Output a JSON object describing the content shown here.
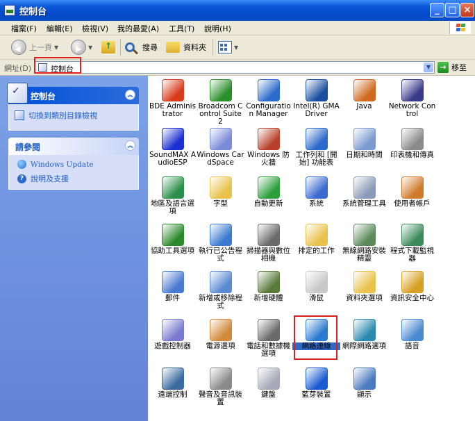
{
  "window": {
    "title": "控制台"
  },
  "menu": [
    "檔案(F)",
    "編輯(E)",
    "檢視(V)",
    "我的最愛(A)",
    "工具(T)",
    "說明(H)"
  ],
  "toolbar": {
    "back_label": "上一頁",
    "search_label": "搜尋",
    "folders_label": "資料夾"
  },
  "address": {
    "label": "網址(D)",
    "value": "控制台",
    "go_label": "移至"
  },
  "left_pane": {
    "panel1_title": "控制台",
    "switch_link": "切換到類別目錄檢視",
    "panel2_title": "請參閱",
    "see_also": [
      "Windows Update",
      "說明及支援"
    ]
  },
  "icons": [
    {
      "label": "BDE Administrator",
      "icon": "bde-icon",
      "color": "#d83a1a"
    },
    {
      "label": "Broadcom Control Suite 2",
      "icon": "broadcom-icon",
      "color": "#2a8f2a"
    },
    {
      "label": "Configuration Manager",
      "icon": "config-manager-icon",
      "color": "#2b6acb"
    },
    {
      "label": "Intel(R) GMA Driver",
      "icon": "intel-gma-icon",
      "color": "#1a4fa0"
    },
    {
      "label": "Java",
      "icon": "java-icon",
      "color": "#d06a1e"
    },
    {
      "label": "Network Control",
      "icon": "network-control-icon",
      "color": "#3a3a8a"
    },
    {
      "label": "SoundMAX AudioESP",
      "icon": "soundmax-icon",
      "color": "#1a2fd0"
    },
    {
      "label": "Windows CardSpace",
      "icon": "cardspace-icon",
      "color": "#7a8bd8"
    },
    {
      "label": "Windows 防火牆",
      "icon": "firewall-icon",
      "color": "#b8402a"
    },
    {
      "label": "工作列和 [開始] 功能表",
      "icon": "taskbar-icon",
      "color": "#2a68c9"
    },
    {
      "label": "日期和時間",
      "icon": "clock-icon",
      "color": "#7a9ad0"
    },
    {
      "label": "印表機和傳真",
      "icon": "printer-icon",
      "color": "#8a8a8a"
    },
    {
      "label": "地區及語言選項",
      "icon": "globe-icon",
      "color": "#2a8f4a"
    },
    {
      "label": "字型",
      "icon": "fonts-folder-icon",
      "color": "#e8c24a"
    },
    {
      "label": "自動更新",
      "icon": "auto-update-icon",
      "color": "#2a9f3a"
    },
    {
      "label": "系統",
      "icon": "system-icon",
      "color": "#3a6ad0"
    },
    {
      "label": "系統管理工具",
      "icon": "admin-tools-icon",
      "color": "#8a9ab8"
    },
    {
      "label": "使用者帳戶",
      "icon": "user-accounts-icon",
      "color": "#d07a2a"
    },
    {
      "label": "協助工具選項",
      "icon": "accessibility-icon",
      "color": "#2a8a2a"
    },
    {
      "label": "執行已公告程式",
      "icon": "advertised-programs-icon",
      "color": "#3a7ad0"
    },
    {
      "label": "掃描器與數位相機",
      "icon": "scanner-icon",
      "color": "#6a6a6a"
    },
    {
      "label": "排定的工作",
      "icon": "scheduled-tasks-icon",
      "color": "#e8c24a"
    },
    {
      "label": "無線網路安裝精靈",
      "icon": "wireless-icon",
      "color": "#5a8a5a"
    },
    {
      "label": "程式下載監視器",
      "icon": "download-monitor-icon",
      "color": "#3a8a5a"
    },
    {
      "label": "郵件",
      "icon": "mail-icon",
      "color": "#4a7ad0"
    },
    {
      "label": "新增或移除程式",
      "icon": "add-remove-icon",
      "color": "#5a8ad0"
    },
    {
      "label": "新增硬體",
      "icon": "add-hardware-icon",
      "color": "#5a7a3a"
    },
    {
      "label": "滑鼠",
      "icon": "mouse-icon",
      "color": "#c8c8c8"
    },
    {
      "label": "資料夾選項",
      "icon": "folder-options-icon",
      "color": "#e8c24a"
    },
    {
      "label": "資訊安全中心",
      "icon": "security-center-icon",
      "color": "#d8a020"
    },
    {
      "label": "遊戲控制器",
      "icon": "game-controller-icon",
      "color": "#7a7ad0"
    },
    {
      "label": "電源選項",
      "icon": "power-icon",
      "color": "#d08a3a"
    },
    {
      "label": "電話和數據機選項",
      "icon": "phone-modem-icon",
      "color": "#6a6a6a"
    },
    {
      "label": "網路連線",
      "icon": "network-connections-icon",
      "color": "#2a7ad0",
      "selected": true
    },
    {
      "label": "網際網路選項",
      "icon": "internet-options-icon",
      "color": "#2a8ab0"
    },
    {
      "label": "語音",
      "icon": "speech-icon",
      "color": "#4a8ad0"
    },
    {
      "label": "遠端控制",
      "icon": "remote-control-icon",
      "color": "#3a6aa0"
    },
    {
      "label": "聲音及音訊裝置",
      "icon": "sound-icon",
      "color": "#8a8a8a"
    },
    {
      "label": "鍵盤",
      "icon": "keyboard-icon",
      "color": "#a8a8b8"
    },
    {
      "label": "藍芽裝置",
      "icon": "bluetooth-icon",
      "color": "#1a5ad0"
    },
    {
      "label": "顯示",
      "icon": "display-icon",
      "color": "#4a7ac0"
    }
  ]
}
